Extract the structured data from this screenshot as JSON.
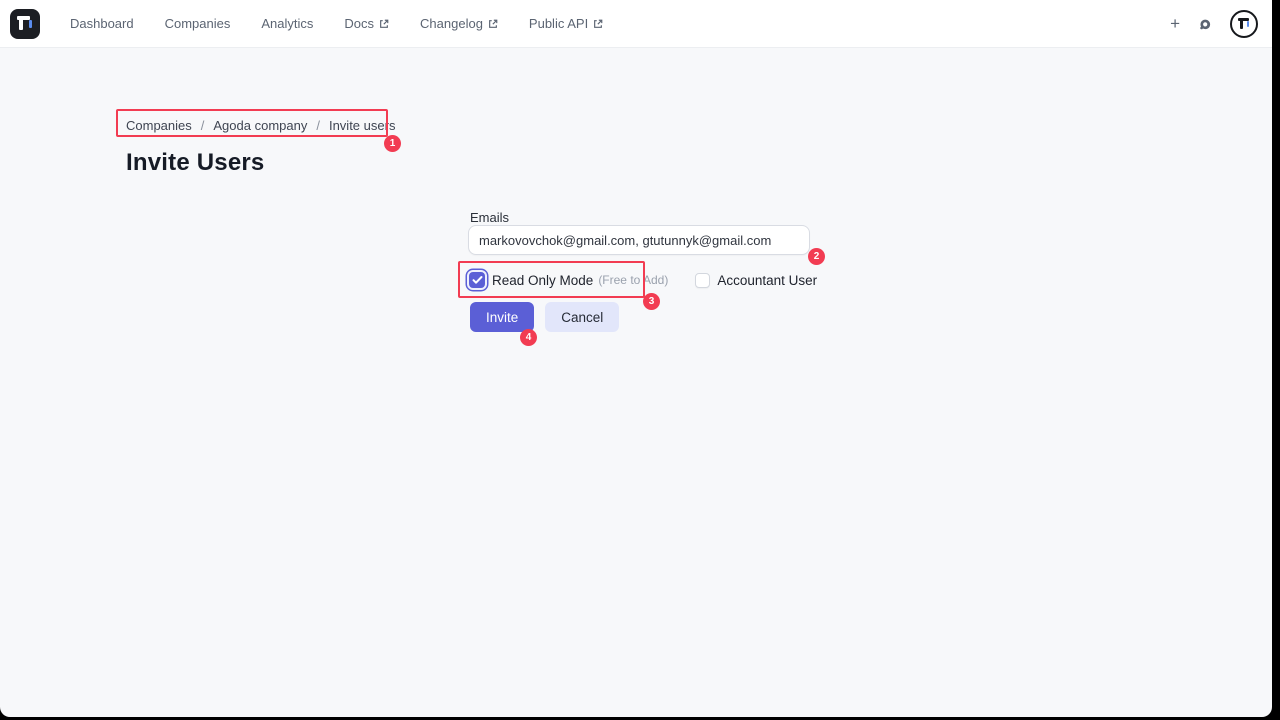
{
  "nav": {
    "brand": "T logo",
    "items": [
      {
        "label": "Dashboard",
        "external": false
      },
      {
        "label": "Companies",
        "external": false
      },
      {
        "label": "Analytics",
        "external": false
      },
      {
        "label": "Docs",
        "external": true
      },
      {
        "label": "Changelog",
        "external": true
      },
      {
        "label": "Public API",
        "external": true
      }
    ],
    "actions": {
      "plus": "+",
      "headset": "support-headset",
      "avatar": "T avatar"
    }
  },
  "breadcrumb": {
    "items": [
      {
        "label": "Companies"
      },
      {
        "label": "Agoda company"
      },
      {
        "label": "Invite users"
      }
    ],
    "separator": "/"
  },
  "page": {
    "title": "Invite Users"
  },
  "form": {
    "emails_label": "Emails",
    "emails_value": "markovovchok@gmail.com, gtutunnyk@gmail.com",
    "read_only_checkbox": {
      "label": "Read Only Mode",
      "hint": "(Free to Add)",
      "checked": true
    },
    "accountant_checkbox": {
      "label": "Accountant User",
      "checked": false
    },
    "invite_label": "Invite",
    "cancel_label": "Cancel"
  },
  "annotations": {
    "badges": [
      "1",
      "2",
      "3",
      "4"
    ],
    "color": "#f23c52"
  },
  "colors": {
    "accent_indigo": "#5b5fd6",
    "cancel_bg": "#e2e6fa",
    "annotation_red": "#f23c52",
    "page_bg": "#f7f8fa",
    "nav_bg": "#ffffff",
    "logo_blue": "#5b8def"
  }
}
